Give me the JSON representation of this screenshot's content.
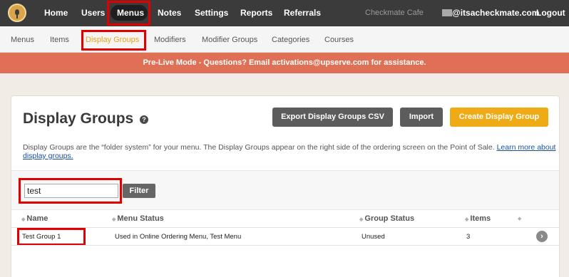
{
  "topnav": {
    "items": [
      {
        "label": "Home"
      },
      {
        "label": "Users"
      },
      {
        "label": "Menus"
      },
      {
        "label": "Notes"
      },
      {
        "label": "Settings"
      },
      {
        "label": "Reports"
      },
      {
        "label": "Referrals"
      }
    ],
    "active": "Menus",
    "cafe_name": "Checkmate Cafe",
    "email": "@itsacheckmate.com",
    "logout_label": "Logout"
  },
  "subnav": {
    "items": [
      {
        "label": "Menus"
      },
      {
        "label": "Items"
      },
      {
        "label": "Display Groups"
      },
      {
        "label": "Modifiers"
      },
      {
        "label": "Modifier Groups"
      },
      {
        "label": "Categories"
      },
      {
        "label": "Courses"
      }
    ],
    "active": "Display Groups"
  },
  "banner": {
    "text": "Pre-Live Mode - Questions? Email activations@upserve.com for assistance."
  },
  "page": {
    "title": "Display Groups",
    "help_icon": "?",
    "buttons": {
      "export": "Export Display Groups CSV",
      "import": "Import",
      "create": "Create Display Group"
    },
    "description": "Display Groups are the “folder system” for your menu. The Display Groups appear on the right side of the ordering screen on the Point of Sale.",
    "learn_more": "Learn more about display groups."
  },
  "filter": {
    "value": "test",
    "button_label": "Filter"
  },
  "table": {
    "columns": [
      "Name",
      "Menu Status",
      "Group Status",
      "Items"
    ],
    "rows": [
      {
        "name": "Test Group 1",
        "menu_status": "Used in Online Ordering Menu, Test Menu",
        "group_status": "Unused",
        "items": "3"
      }
    ]
  },
  "colors": {
    "topnav_bg": "#3b3b3b",
    "banner_bg": "#e07055",
    "accent": "#efab16",
    "highlight": "#e00000"
  }
}
